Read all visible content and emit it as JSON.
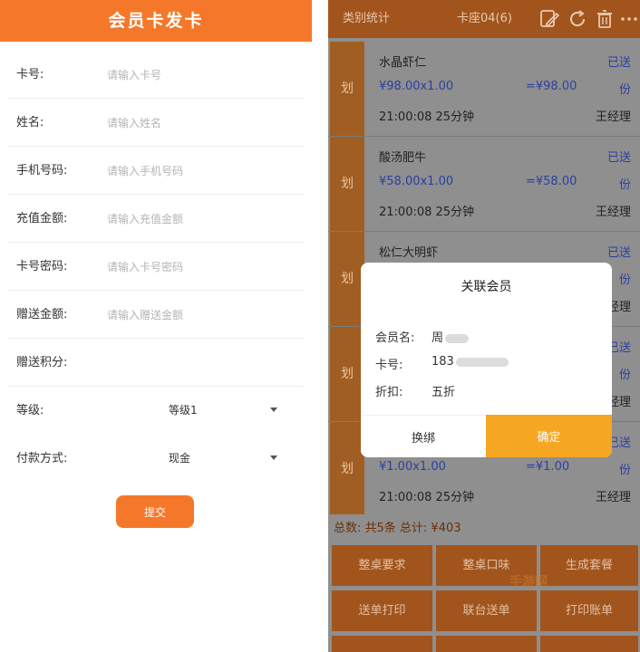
{
  "left_form": {
    "title": "会员卡发卡",
    "fields": [
      {
        "label": "卡号:",
        "placeholder": "请输入卡号"
      },
      {
        "label": "姓名:",
        "placeholder": "请输入姓名"
      },
      {
        "label": "手机号码:",
        "placeholder": "请输入手机号码"
      },
      {
        "label": "充值金额:",
        "placeholder": "请输入充值金额"
      },
      {
        "label": "卡号密码:",
        "placeholder": "请输入卡号密码"
      },
      {
        "label": "赠送金额:",
        "placeholder": "请输入赠送金额"
      },
      {
        "label": "赠送积分:",
        "placeholder": ""
      }
    ],
    "level": {
      "label": "等级:",
      "value": "等级1"
    },
    "payment": {
      "label": "付款方式:",
      "value": "现金"
    },
    "submit_label": "提交"
  },
  "right_panel": {
    "header": {
      "left": "类别统计",
      "mid": "卡座04(6)"
    },
    "items": [
      {
        "tag": "划",
        "name": "水晶虾仁",
        "price": "¥98.00x1.00",
        "total": "=¥98.00",
        "time": "21:00:08  25分钟",
        "status": "已送",
        "unit": "份",
        "waiter": "王经理"
      },
      {
        "tag": "划",
        "name": "酸汤肥牛",
        "price": "¥58.00x1.00",
        "total": "=¥58.00",
        "time": "21:00:08  25分钟",
        "status": "已送",
        "unit": "份",
        "waiter": "王经理"
      },
      {
        "tag": "划",
        "name": "松仁大明虾",
        "price": "",
        "total": "",
        "time": "",
        "status": "已送",
        "unit": "份",
        "waiter": "经理"
      },
      {
        "tag": "划",
        "name": "",
        "price": "",
        "total": "",
        "time": "",
        "status": "已送",
        "unit": "份",
        "waiter": "经理"
      },
      {
        "tag": "划",
        "name": "",
        "price": "¥1.00x1.00",
        "total": "=¥1.00",
        "time": "21:00:08  25分钟",
        "status": "已送",
        "unit": "份",
        "waiter": "王经理"
      }
    ],
    "summary": "总数: 共5条 总计: ¥403",
    "buttons": [
      "整桌要求",
      "整桌口味",
      "生成套餐",
      "送单打印",
      "联台送单",
      "打印账单"
    ],
    "watermark": "手游网"
  },
  "modal": {
    "title": "关联会员",
    "member_label": "会员名:",
    "member_value": "周",
    "card_label": "卡号:",
    "card_value": "183",
    "discount_label": "折扣:",
    "discount_value": "五折",
    "unbind_label": "换绑",
    "confirm_label": "确定"
  },
  "colors": {
    "accent": "#f5782a",
    "dark_orange": "#a1551d",
    "confirm": "#f5a623",
    "blue_text": "#2b3fa2"
  }
}
